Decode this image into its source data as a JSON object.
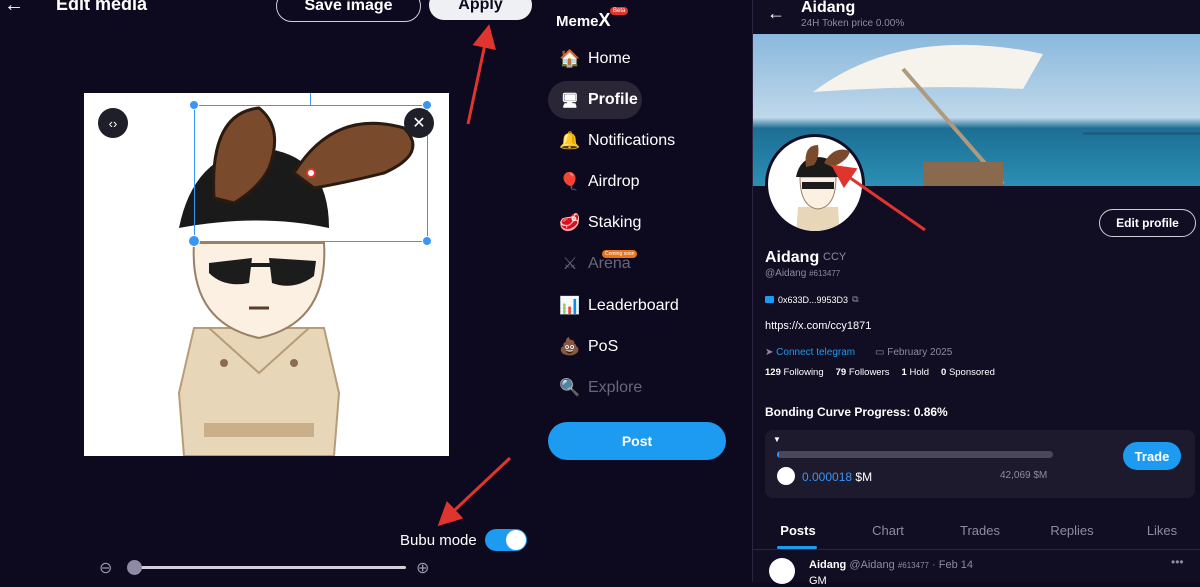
{
  "editor": {
    "title": "Edit media",
    "save_label": "Save image",
    "apply_label": "Apply",
    "bubu_label": "Bubu mode",
    "bubu_on": true,
    "zoom_level": 0.0
  },
  "nav": {
    "logo_text": "Meme",
    "logo_x": "X",
    "logo_badge": "Beta",
    "items": [
      {
        "label": "Home",
        "icon": "🏠"
      },
      {
        "label": "Profile",
        "icon": "🖥"
      },
      {
        "label": "Notifications",
        "icon": "🔔"
      },
      {
        "label": "Airdrop",
        "icon": "🎈"
      },
      {
        "label": "Staking",
        "icon": "🥩"
      },
      {
        "label": "Arena",
        "icon": "⚔"
      },
      {
        "label": "Leaderboard",
        "icon": "📊"
      },
      {
        "label": "PoS",
        "icon": "💩"
      },
      {
        "label": "Explore",
        "icon": "🔍"
      }
    ],
    "arena_badge": "Coming soon",
    "post_label": "Post"
  },
  "profile": {
    "header_name": "Aidang",
    "token_price": "24H Token price",
    "token_change": "0.00%",
    "edit_label": "Edit profile",
    "name": "Aidang",
    "ticker": "CCY",
    "handle": "@Aidang",
    "handle_num": "#613477",
    "wallet": "0x633D...9953D3",
    "link": "https://x.com/ccy1871",
    "telegram": "Connect telegram",
    "joined": "February 2025",
    "following_count": "129",
    "following_label": "Following",
    "followers_count": "79",
    "followers_label": "Followers",
    "hold_count": "1",
    "hold_label": "Hold",
    "sponsored_count": "0",
    "sponsored_label": "Sponsored",
    "bonding_label": "Bonding Curve Progress: 0.86%",
    "bonding_progress": 0.0086,
    "price_value": "0.000018",
    "price_unit": "$M",
    "market_cap": "42,069 $M",
    "trade_label": "Trade",
    "tabs": [
      "Posts",
      "Chart",
      "Trades",
      "Replies",
      "Likes"
    ],
    "post_name": "Aidang",
    "post_handle": "@Aidang",
    "post_num": "#613477",
    "post_date": "Feb 14",
    "post_text": "GM"
  },
  "colors": {
    "accent": "#1d9bf0",
    "bg": "#0d0a1f",
    "arrow": "#e0342f"
  }
}
